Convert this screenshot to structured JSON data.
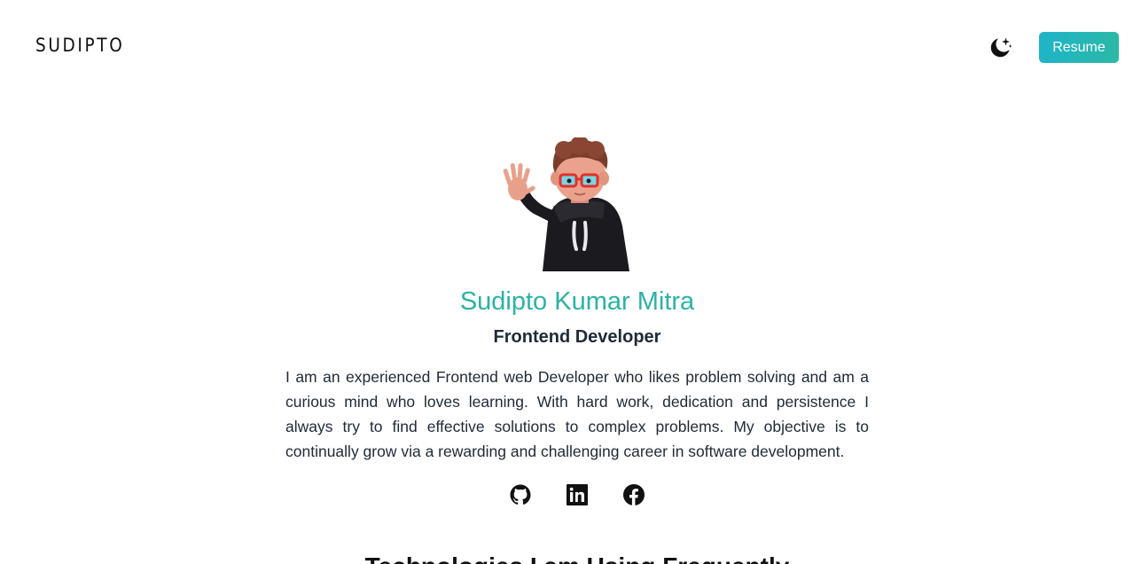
{
  "header": {
    "logo": "SUDIPTO",
    "theme_icon": "moon-sparkle-icon",
    "resume_label": "Resume"
  },
  "hero": {
    "avatar_icon": "waving-avatar",
    "name": "Sudipto Kumar Mitra",
    "role": "Frontend Developer",
    "bio": "I am an experienced Frontend web Developer who likes problem solving and am a curious mind who loves learning. With hard work, dedication and persistence I always try to find effective solutions to complex problems. My objective is to continually grow via a rewarding and challenging career in software development."
  },
  "socials": [
    {
      "icon": "github-icon"
    },
    {
      "icon": "linkedin-icon"
    },
    {
      "icon": "facebook-icon"
    }
  ],
  "next_section": {
    "heading": "Technologies I am Using Frequently"
  },
  "colors": {
    "accent": "#2bb3a3",
    "button_start": "#1fb4c8",
    "button_end": "#2bb8a6",
    "text": "#1f2937"
  }
}
